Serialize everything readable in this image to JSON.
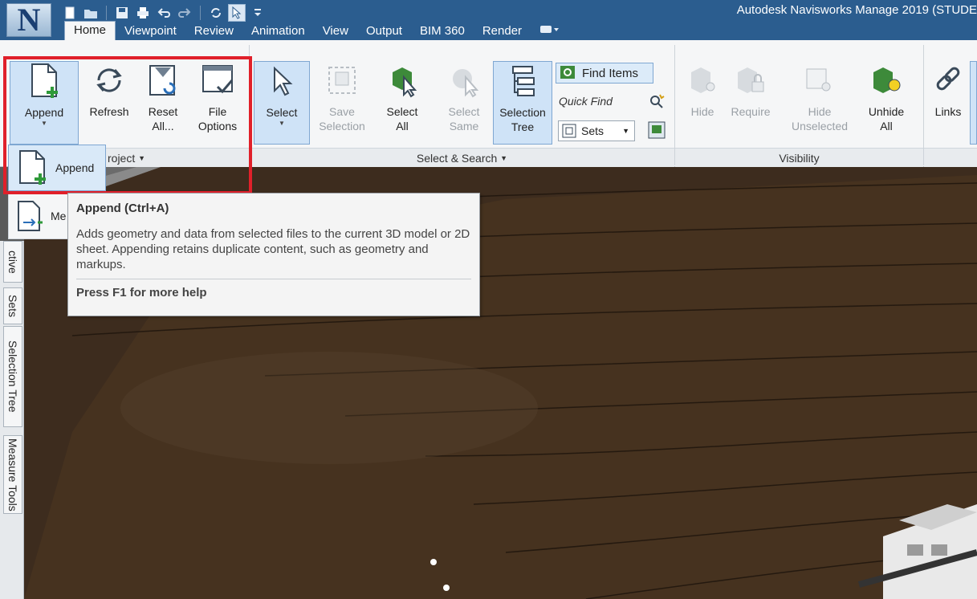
{
  "app": {
    "logo_letter": "N",
    "window_title": "Autodesk Navisworks Manage 2019 (STUDE"
  },
  "tabs": [
    {
      "label": "Home",
      "active": true
    },
    {
      "label": "Viewpoint"
    },
    {
      "label": "Review"
    },
    {
      "label": "Animation"
    },
    {
      "label": "View"
    },
    {
      "label": "Output"
    },
    {
      "label": "BIM 360"
    },
    {
      "label": "Render"
    }
  ],
  "ribbon": {
    "append": "Append",
    "refresh": "Refresh",
    "reset_all_1": "Reset",
    "reset_all_2": "All...",
    "file_options_1": "File",
    "file_options_2": "Options",
    "select": "Select",
    "save_selection_1": "Save",
    "save_selection_2": "Selection",
    "select_all_1": "Select",
    "select_all_2": "All",
    "select_same_1": "Select",
    "select_same_2": "Same",
    "selection_tree_1": "Selection",
    "selection_tree_2": "Tree",
    "find_items": "Find Items",
    "quick_find": "Quick Find",
    "sets": "Sets",
    "hide": "Hide",
    "require": "Require",
    "hide_unselected_1": "Hide",
    "hide_unselected_2": "Unselected",
    "unhide_all_1": "Unhide",
    "unhide_all_2": "All",
    "links": "Links",
    "panel_project": "roject",
    "panel_select_search": "Select & Search",
    "panel_visibility": "Visibility"
  },
  "dropdown": {
    "append_item": "Append",
    "merge_item": "Me"
  },
  "tooltip": {
    "title": "Append (Ctrl+A)",
    "description": "Adds geometry and data from selected files to the current 3D model or 2D sheet. Appending retains duplicate content, such as geometry and markups.",
    "help": "Press F1 for more help"
  },
  "side_tabs": [
    "ctive",
    "Sets",
    "Selection Tree",
    "Measure Tools"
  ],
  "colors": {
    "title_bar": "#2b5d8f",
    "highlight": "#e0202a",
    "terrain": "#3d2c1e"
  }
}
